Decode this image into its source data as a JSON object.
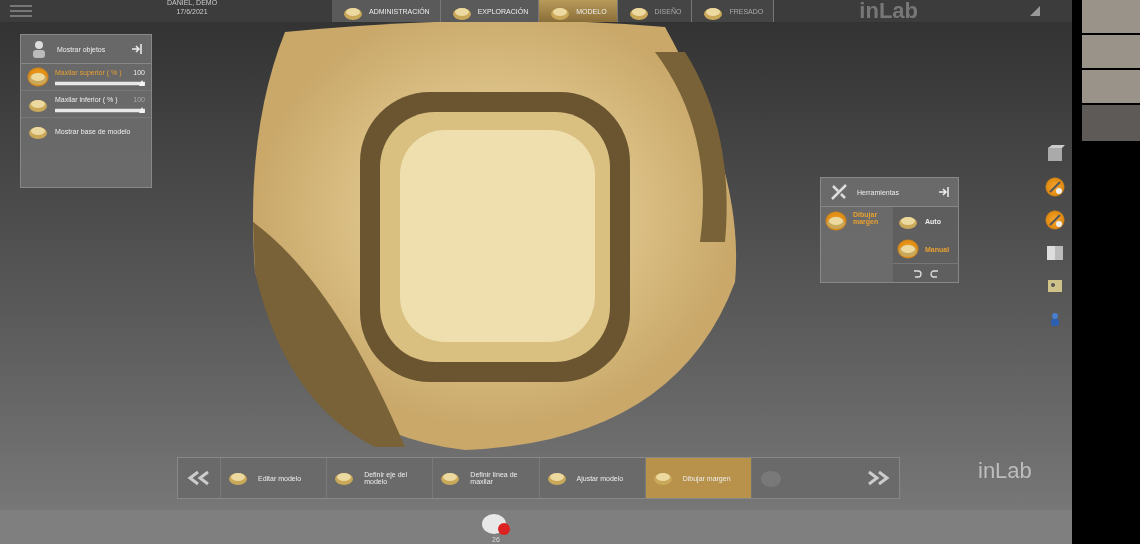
{
  "header": {
    "patient": "DANIEL, DEMO",
    "date": "17/6/2021",
    "logo": "inLab"
  },
  "phases": [
    {
      "label": "ADMINISTRACIÓN",
      "selected": false,
      "disabled": false
    },
    {
      "label": "EXPLORACIÓN",
      "selected": false,
      "disabled": false
    },
    {
      "label": "MODELO",
      "selected": true,
      "disabled": false
    },
    {
      "label": "DISEÑO",
      "selected": false,
      "disabled": true
    },
    {
      "label": "FRESADO",
      "selected": false,
      "disabled": true
    }
  ],
  "objects_panel": {
    "title": "Mostrar objetos",
    "items": [
      {
        "kind": "slider",
        "label": "Maxilar superior ( % )",
        "value": "100",
        "level": 1,
        "selected": true
      },
      {
        "kind": "slider",
        "label": "Maxilar inferior ( % )",
        "value": "100",
        "level": 1,
        "selected": false
      },
      {
        "kind": "toggle",
        "label": "Mostrar base de modelo",
        "selected": false
      }
    ]
  },
  "tools_panel": {
    "title": "Herramientas",
    "tool": "Dibujar margen",
    "options": [
      {
        "label": "Auto",
        "selected": false
      },
      {
        "label": "Manual",
        "selected": true
      }
    ]
  },
  "side_toolbar": [
    {
      "kind": "cube",
      "active": false
    },
    {
      "kind": "tool",
      "active": true
    },
    {
      "kind": "tool",
      "active": true
    },
    {
      "kind": "book",
      "active": false
    },
    {
      "kind": "model",
      "active": false
    },
    {
      "kind": "figure",
      "active": false
    }
  ],
  "steps": [
    {
      "label": "Editar modelo",
      "selected": false,
      "disabled": false
    },
    {
      "label": "Definir eje del modelo",
      "selected": false,
      "disabled": false
    },
    {
      "label": "Definir línea de maxilar",
      "selected": false,
      "disabled": false
    },
    {
      "label": "Ajustar modelo",
      "selected": false,
      "disabled": false
    },
    {
      "label": "Dibujar margen",
      "selected": true,
      "disabled": false
    },
    {
      "selected": false,
      "disabled": true
    }
  ],
  "restoration": {
    "tooth_number": "26"
  },
  "watermark_logo": "inLab"
}
